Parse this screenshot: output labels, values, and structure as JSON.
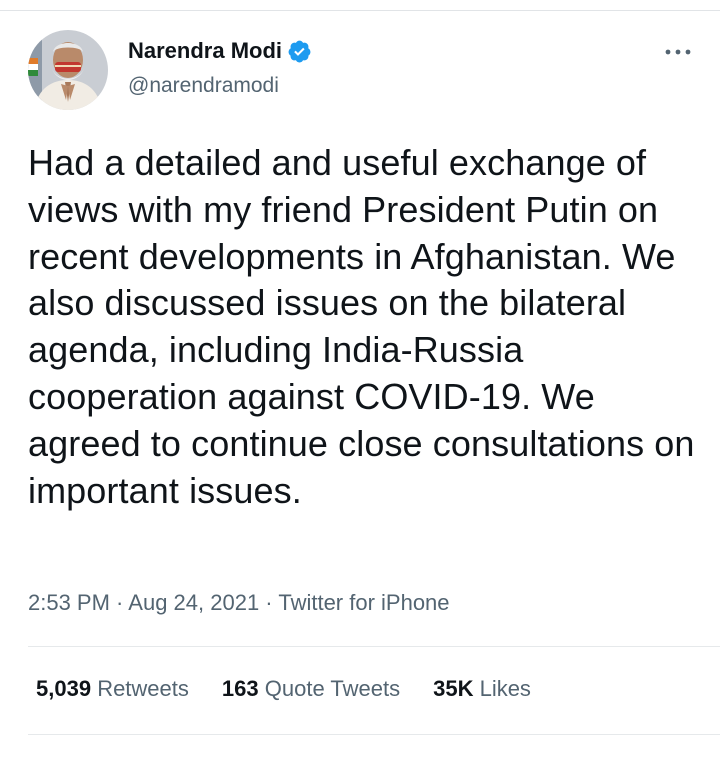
{
  "author": {
    "name": "Narendra Modi",
    "handle": "@narendramodi",
    "verified": true
  },
  "tweet": {
    "text": "Had a detailed and useful exchange of views with my friend President Putin on recent developments in Afghanistan. We also discussed issues on the bilateral agenda, including India-Russia cooperation against COVID-19. We agreed to continue close consultations on important issues.",
    "time": "2:53 PM",
    "date": "Aug 24, 2021",
    "source": "Twitter for iPhone",
    "separator": " · "
  },
  "stats": {
    "retweets_count": "5,039",
    "retweets_label": "Retweets",
    "quotes_count": "163",
    "quotes_label": "Quote Tweets",
    "likes_count": "35K",
    "likes_label": "Likes"
  },
  "icons": {
    "verified": "verified-badge-icon",
    "more": "more-dots-icon"
  },
  "colors": {
    "verified_blue": "#1d9bf0",
    "text_primary": "#0f1419",
    "text_secondary": "#536471",
    "divider": "#e6e9eb"
  }
}
